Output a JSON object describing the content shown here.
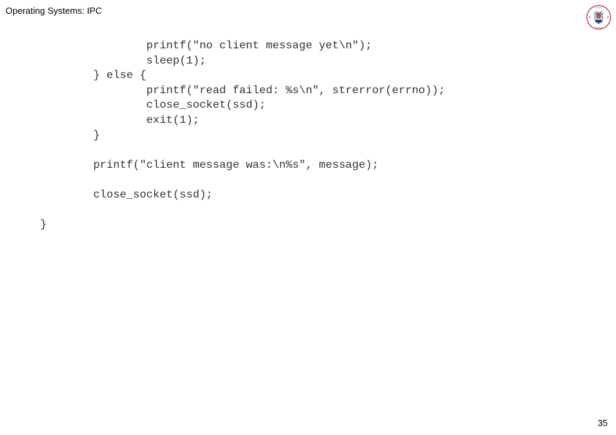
{
  "header": {
    "title": "Operating Systems: IPC"
  },
  "code": {
    "line1": "                printf(\"no client message yet\\n\");",
    "line2": "                sleep(1);",
    "line3": "        } else {",
    "line4": "                printf(\"read failed: %s\\n\", strerror(errno));",
    "line5": "                close_socket(ssd);",
    "line6": "                exit(1);",
    "line7": "        }",
    "line8": "",
    "line9": "        printf(\"client message was:\\n%s\", message);",
    "line10": "",
    "line11": "        close_socket(ssd);",
    "line12": "",
    "line13": "}"
  },
  "footer": {
    "page_number": "35"
  },
  "crest": {
    "name": "university-of-edinburgh-crest"
  }
}
